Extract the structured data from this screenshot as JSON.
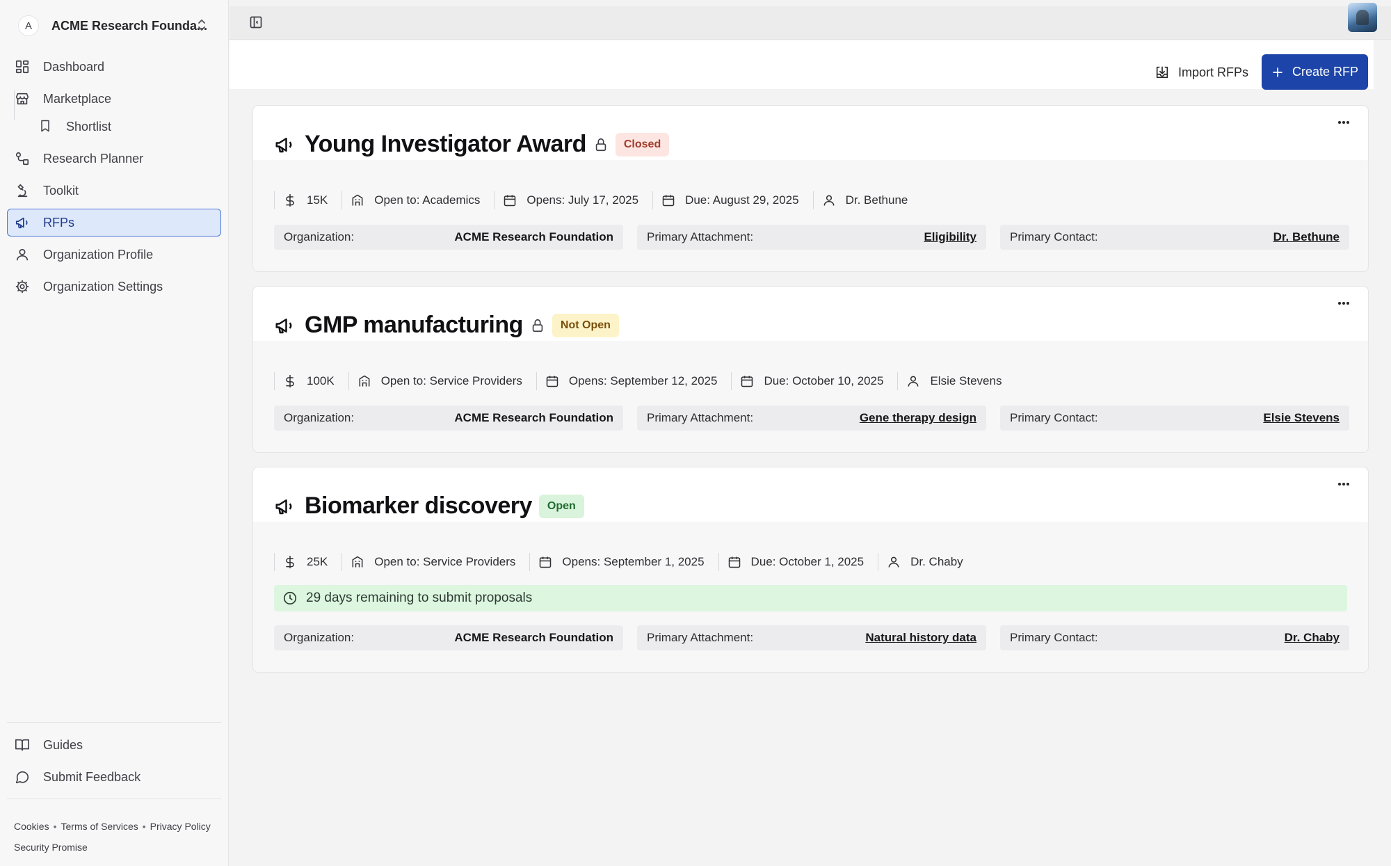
{
  "sidebar": {
    "org_initial": "A",
    "org_name": "ACME Research Founda...",
    "nav": [
      {
        "label": "Dashboard"
      },
      {
        "label": "Marketplace"
      },
      {
        "label": "Shortlist"
      },
      {
        "label": "Research Planner"
      },
      {
        "label": "Toolkit"
      },
      {
        "label": "RFPs"
      },
      {
        "label": "Organization Profile"
      },
      {
        "label": "Organization Settings"
      }
    ],
    "bottom": [
      {
        "label": "Guides"
      },
      {
        "label": "Submit Feedback"
      }
    ],
    "footer": {
      "cookies": "Cookies",
      "terms": "Terms of Services",
      "privacy": "Privacy Policy",
      "security": "Security Promise"
    }
  },
  "header": {
    "import_label": "Import RFPs",
    "create_label": "Create RFP"
  },
  "rfps": [
    {
      "title": "Young Investigator Award",
      "status": "Closed",
      "amount": "15K",
      "open_to": "Open to: Academics",
      "opens": "Opens: July 17, 2025",
      "due": "Due: August 29, 2025",
      "contact": "Dr. Bethune",
      "org_label": "Organization:",
      "org_value": "ACME Research Foundation",
      "attach_label": "Primary Attachment:",
      "attach_value": "Eligibility",
      "contact_label": "Primary Contact:",
      "contact_value": "Dr. Bethune"
    },
    {
      "title": "GMP manufacturing",
      "status": "Not Open",
      "amount": "100K",
      "open_to": "Open to: Service Providers",
      "opens": "Opens: September 12, 2025",
      "due": "Due: October 10, 2025",
      "contact": "Elsie Stevens",
      "org_label": "Organization:",
      "org_value": "ACME Research Foundation",
      "attach_label": "Primary Attachment:",
      "attach_value": "Gene therapy design",
      "contact_label": "Primary Contact:",
      "contact_value": "Elsie Stevens"
    },
    {
      "title": "Biomarker discovery",
      "status": "Open",
      "amount": "25K",
      "open_to": "Open to: Service Providers",
      "opens": "Opens: September 1, 2025",
      "due": "Due: October 1, 2025",
      "contact": "Dr. Chaby",
      "remaining": "29 days remaining to submit proposals",
      "org_label": "Organization:",
      "org_value": "ACME Research Foundation",
      "attach_label": "Primary Attachment:",
      "attach_value": "Natural history data",
      "contact_label": "Primary Contact:",
      "contact_value": "Dr. Chaby"
    }
  ],
  "colors": {
    "primary": "#1d44a8",
    "active_nav_bg": "#dde8fb",
    "closed": "#a13c2a",
    "not_open": "#7a4e0d",
    "open": "#1f6b2f"
  }
}
